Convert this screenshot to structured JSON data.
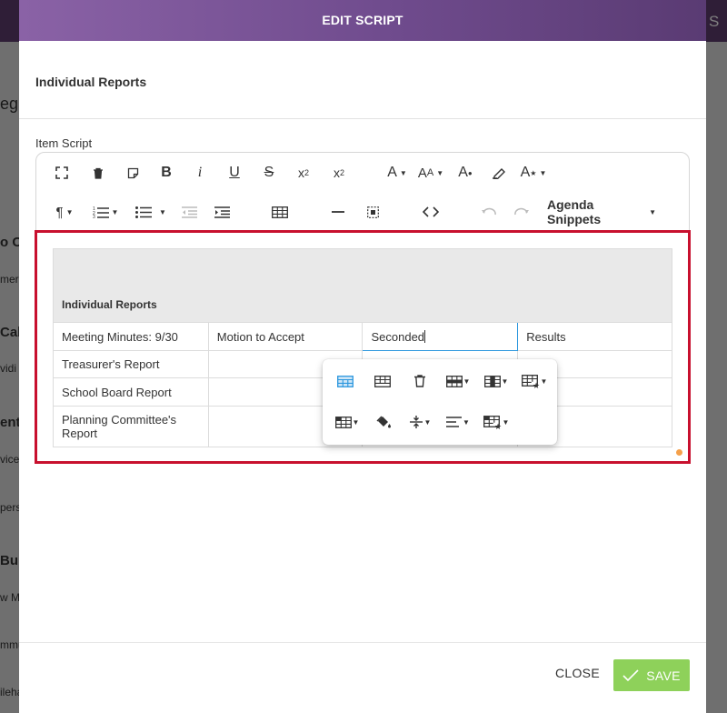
{
  "background": {
    "fragments": [
      "S",
      "egis",
      "o C",
      "mer",
      "Cal",
      "vidi",
      "ent",
      "vice",
      "pers",
      "Bu",
      "w M",
      "mmu",
      "ileha"
    ]
  },
  "modal": {
    "title": "EDIT SCRIPT",
    "section_title": "Individual Reports",
    "field_label": "Item Script"
  },
  "toolbar": {
    "row1": [
      "fullscreen-icon",
      "trash-icon",
      "note-icon",
      "bold-icon",
      "italic-icon",
      "underline-icon",
      "strikethrough-icon",
      "subscript-icon",
      "superscript-icon",
      "text-color-icon",
      "font-size-icon",
      "ink-drop-icon",
      "highlighter-icon",
      "text-effects-icon"
    ],
    "row2": [
      "paragraph-icon",
      "ordered-list-icon",
      "unordered-list-icon",
      "outdent-icon",
      "indent-icon",
      "insert-table-icon",
      "horizontal-rule-icon",
      "select-all-icon",
      "code-view-icon",
      "undo-icon",
      "redo-icon"
    ],
    "snippets_label": "Agenda Snippets"
  },
  "table": {
    "header": "Individual Reports",
    "rows": [
      [
        "Meeting Minutes: 9/30",
        "Motion to Accept",
        "Seconded",
        "Results"
      ],
      [
        "Treasurer's Report",
        "",
        "",
        ""
      ],
      [
        "School Board Report",
        "",
        "",
        ""
      ],
      [
        "Planning Committee's Report",
        "",
        "",
        ""
      ]
    ]
  },
  "table_popup": {
    "buttons": [
      "table-header-icon",
      "table-footer-icon",
      "table-remove-icon",
      "table-rows-icon",
      "table-columns-icon",
      "table-style-icon",
      "cell-icon",
      "cell-background-icon",
      "vertical-align-icon",
      "horizontal-align-icon",
      "cell-style-icon"
    ]
  },
  "footer": {
    "close_label": "CLOSE",
    "save_label": "SAVE"
  },
  "colors": {
    "header_gradient_start": "#8a62a6",
    "header_gradient_end": "#5a3b73",
    "focus_border": "#c8102e",
    "save_button": "#8ed15a",
    "selected_cell_border": "#2c97de"
  }
}
